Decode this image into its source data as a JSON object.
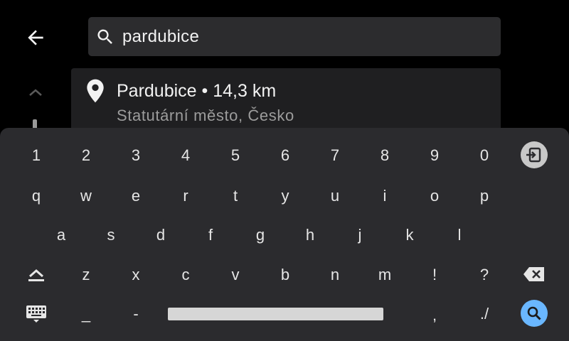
{
  "search": {
    "value": "pardubice"
  },
  "result": {
    "title": "Pardubice • 14,3 km",
    "subtitle": "Statutární město, Česko"
  },
  "icons": {
    "back": "arrow-left-icon",
    "search": "search-icon",
    "pin": "location-pin-icon",
    "scroll_up": "chevron-up-icon",
    "exit": "exit-keyboard-icon",
    "shift": "shift-icon",
    "backspace": "backspace-icon",
    "keyboard": "keyboard-icon",
    "search_key": "search-icon"
  },
  "colors": {
    "accent": "#6ab7ff",
    "background": "#000000",
    "card": "#1f1f21",
    "keyboard": "#2b2b2e"
  },
  "keyboard": {
    "rows": [
      [
        "1",
        "2",
        "3",
        "4",
        "5",
        "6",
        "7",
        "8",
        "9",
        "0"
      ],
      [
        "q",
        "w",
        "e",
        "r",
        "t",
        "y",
        "u",
        "i",
        "o",
        "p"
      ],
      [
        "a",
        "s",
        "d",
        "f",
        "g",
        "h",
        "j",
        "k",
        "l"
      ],
      [
        "z",
        "x",
        "c",
        "v",
        "b",
        "n",
        "m",
        "!",
        "?"
      ],
      [
        "_",
        "-",
        ",",
        "./"
      ]
    ]
  }
}
